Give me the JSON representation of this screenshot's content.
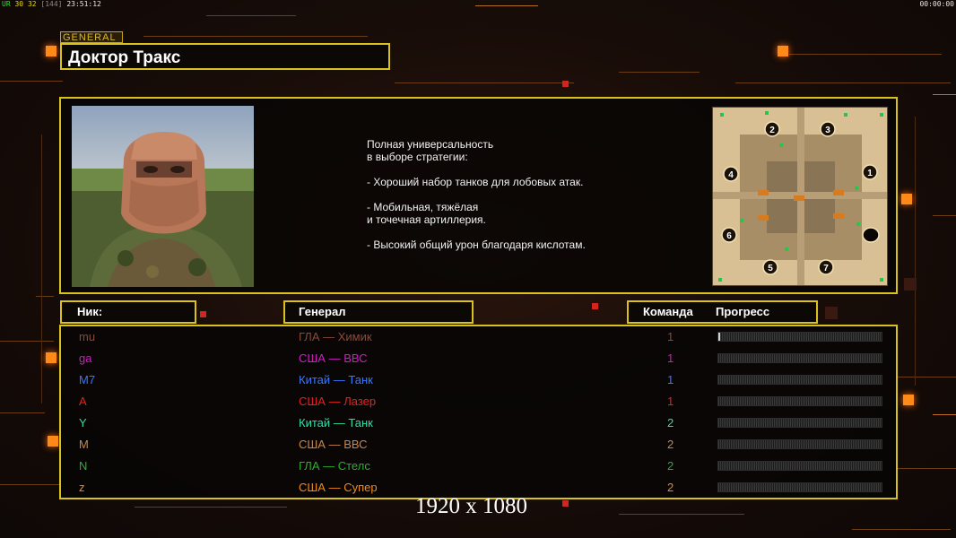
{
  "hud": {
    "left_ur": "UR",
    "left_a": "30",
    "left_b": "32",
    "left_c": "[144]",
    "left_time": "23:51:12",
    "right_time": "00:00:00"
  },
  "general": {
    "tag": "GENERAL",
    "name": "Доктор Тракс",
    "description_lines": [
      "Полная универсальность",
      "в выборе стратегии:",
      "",
      "- Хороший набор танков для лобовых атак.",
      "",
      "- Мобильная, тяжёлая",
      "и точечная артиллерия.",
      "",
      "- Высокий общий урон благодаря кислотам."
    ]
  },
  "map": {
    "spawns": [
      "1",
      "2",
      "3",
      "4",
      "5",
      "6",
      "7"
    ]
  },
  "table": {
    "headers": {
      "nick": "Ник:",
      "general": "Генерал",
      "team": "Команда",
      "progress": "Прогресс"
    },
    "rows": [
      {
        "nick": "mu",
        "general": "ГЛА — Химик",
        "team": "1",
        "color": "#8a4a3a",
        "progress": 0.01
      },
      {
        "nick": "ga",
        "general": "США — ВВС",
        "team": "1",
        "color": "#d41ac8",
        "progress": 0
      },
      {
        "nick": "M7",
        "general": "Китай — Танк",
        "team": "1",
        "color": "#3a78ff",
        "progress": 0
      },
      {
        "nick": "A",
        "general": "США — Лазер",
        "team": "1",
        "color": "#e8201c",
        "progress": 0
      },
      {
        "nick": "Y",
        "general": "Китай — Танк",
        "team": "2",
        "color": "#2ee0a8",
        "progress": 0
      },
      {
        "nick": "M",
        "general": "США — ВВС",
        "team": "2",
        "color": "#c8884a",
        "progress": 0
      },
      {
        "nick": "N",
        "general": "ГЛА — Стелс",
        "team": "2",
        "color": "#2ab02a",
        "progress": 0
      },
      {
        "nick": "z",
        "general": "США — Супер",
        "team": "2",
        "color": "#f08a18",
        "progress": 0
      }
    ]
  },
  "watermark": "1920 x 1080"
}
